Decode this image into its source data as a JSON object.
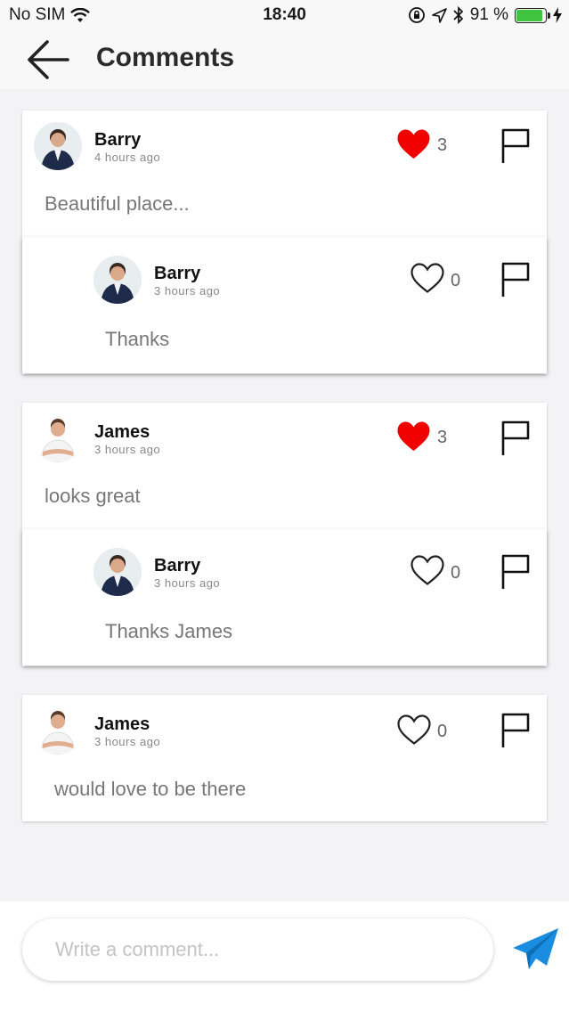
{
  "status_bar": {
    "carrier": "No SIM",
    "time": "18:40",
    "battery": "91 %",
    "battery_level": 0.91
  },
  "header": {
    "title": "Comments"
  },
  "comments": [
    {
      "author": "Barry",
      "time": "4 hours ago",
      "text": "Beautiful place...",
      "likes": "3",
      "liked": true,
      "reply": {
        "author": "Barry",
        "time": "3 hours ago",
        "text": "Thanks",
        "likes": "0",
        "liked": false
      }
    },
    {
      "author": "James",
      "time": "3 hours ago",
      "text": "looks great",
      "likes": "3",
      "liked": true,
      "reply": {
        "author": "Barry",
        "time": "3 hours ago",
        "text": "Thanks James",
        "likes": "0",
        "liked": false
      }
    },
    {
      "author": "James",
      "time": "3 hours ago",
      "text": "would love to be there",
      "likes": "0",
      "liked": false
    }
  ],
  "composer": {
    "placeholder": "Write a comment..."
  },
  "colors": {
    "like_red": "#f10000",
    "send_blue": "#1a8de0",
    "battery_green": "#3ec43e"
  }
}
